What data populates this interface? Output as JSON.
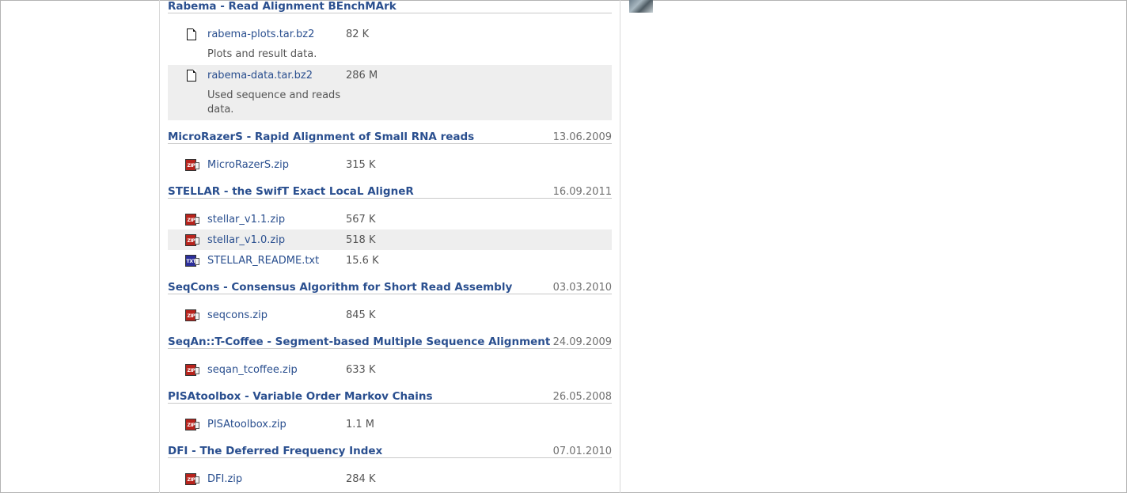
{
  "sections": [
    {
      "title": "Rabema - Read Alignment BEnchMArk",
      "date": "",
      "files": [
        {
          "name": "rabema-plots.tar.bz2",
          "size": "82 K",
          "icon": "doc",
          "description": "Plots and result data.",
          "shaded": false
        },
        {
          "name": "rabema-data.tar.bz2",
          "size": "286 M",
          "icon": "doc",
          "description": "Used sequence and reads data.",
          "shaded": true
        }
      ]
    },
    {
      "title": "MicroRazerS - Rapid Alignment of Small RNA reads",
      "date": "13.06.2009",
      "files": [
        {
          "name": "MicroRazerS.zip",
          "size": "315 K",
          "icon": "zip",
          "shaded": false
        }
      ]
    },
    {
      "title": "STELLAR - the SwifT Exact LocaL AligneR",
      "date": "16.09.2011",
      "files": [
        {
          "name": "stellar_v1.1.zip",
          "size": "567 K",
          "icon": "zip",
          "shaded": false
        },
        {
          "name": "stellar_v1.0.zip",
          "size": "518 K",
          "icon": "zip",
          "shaded": true
        },
        {
          "name": "STELLAR_README.txt",
          "size": "15.6 K",
          "icon": "txt",
          "shaded": false
        }
      ]
    },
    {
      "title": "SeqCons - Consensus Algorithm for Short Read Assembly",
      "date": "03.03.2010",
      "files": [
        {
          "name": "seqcons.zip",
          "size": "845 K",
          "icon": "zip",
          "shaded": false
        }
      ]
    },
    {
      "title": "SeqAn::T-Coffee - Segment-based Multiple Sequence Alignment",
      "date": "24.09.2009",
      "files": [
        {
          "name": "seqan_tcoffee.zip",
          "size": "633 K",
          "icon": "zip",
          "shaded": false
        }
      ]
    },
    {
      "title": "PISAtoolbox - Variable Order Markov Chains",
      "date": "26.05.2008",
      "files": [
        {
          "name": "PISAtoolbox.zip",
          "size": "1.1 M",
          "icon": "zip",
          "shaded": false
        }
      ]
    },
    {
      "title": "DFI - The Deferred Frequency Index",
      "date": "07.01.2010",
      "files": [
        {
          "name": "DFI.zip",
          "size": "284 K",
          "icon": "zip",
          "shaded": false
        }
      ]
    }
  ],
  "icon_labels": {
    "zip": "ZIP",
    "txt": "TXT"
  },
  "colors": {
    "link": "#2a4f8f",
    "text": "#555555",
    "date": "#707070",
    "row_shade": "#eeeeee",
    "zip_icon": "#b8231c",
    "txt_icon": "#2c2f9a"
  }
}
